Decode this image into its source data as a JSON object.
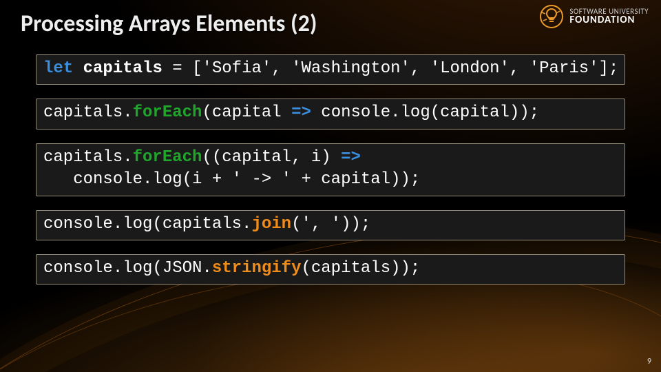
{
  "slide": {
    "title": "Processing Arrays Elements (2)",
    "page_number": "9"
  },
  "logo": {
    "line1": "SOFTWARE UNIVERSITY",
    "line2": "FOUNDATION"
  },
  "code": {
    "b1": {
      "kw": "let",
      "sp": " ",
      "name": "capitals",
      "rest": " = ['Sofia', 'Washington', 'London', 'Paris'];"
    },
    "b2": {
      "pre": "capitals.",
      "fn": "forEach",
      "mid1": "(capital ",
      "arrow": "=>",
      "mid2": " console.log(capital));"
    },
    "b3": {
      "l1": {
        "pre": "capitals.",
        "fn": "forEach",
        "mid1": "((capital, i) ",
        "arrow": "=>"
      },
      "l2": "   console.log(i + ' -> ' + capital));"
    },
    "b4": {
      "pre": "console.log(capitals.",
      "fn": "join",
      "post": "(', '));"
    },
    "b5": {
      "pre": "console.log(JSON.",
      "fn": "stringify",
      "post": "(capitals));"
    }
  }
}
